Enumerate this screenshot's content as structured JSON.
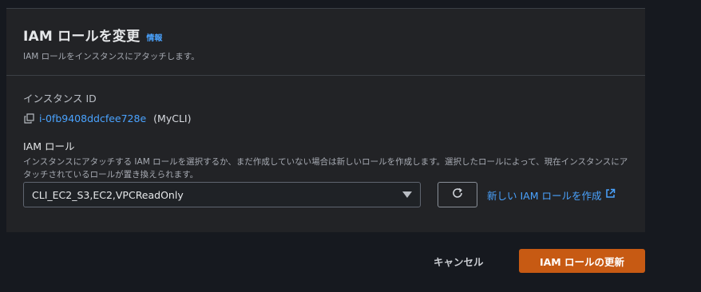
{
  "panel": {
    "title": "IAM ロールを変更",
    "info_link": "情報",
    "description": "IAM ロールをインスタンスにアタッチします。"
  },
  "instance": {
    "label": "インスタンス ID",
    "id": "i-0fb9408ddcfee728e",
    "name": "(MyCLI)"
  },
  "iam_role": {
    "label": "IAM ロール",
    "description": "インスタンスにアタッチする IAM ロールを選択するか、まだ作成していない場合は新しいロールを作成します。選択したロールによって、現在インスタンスにアタッチされているロールが置き換えられます。",
    "selected": "CLI_EC2_S3,EC2,VPCReadOnly",
    "create_link": "新しい IAM ロールを作成"
  },
  "footer": {
    "cancel_label": "キャンセル",
    "submit_label": "IAM ロールの更新"
  },
  "colors": {
    "accent": "#4aa3ff",
    "primary_button": "#c75a13",
    "background": "#16191f",
    "panel": "#222326"
  }
}
